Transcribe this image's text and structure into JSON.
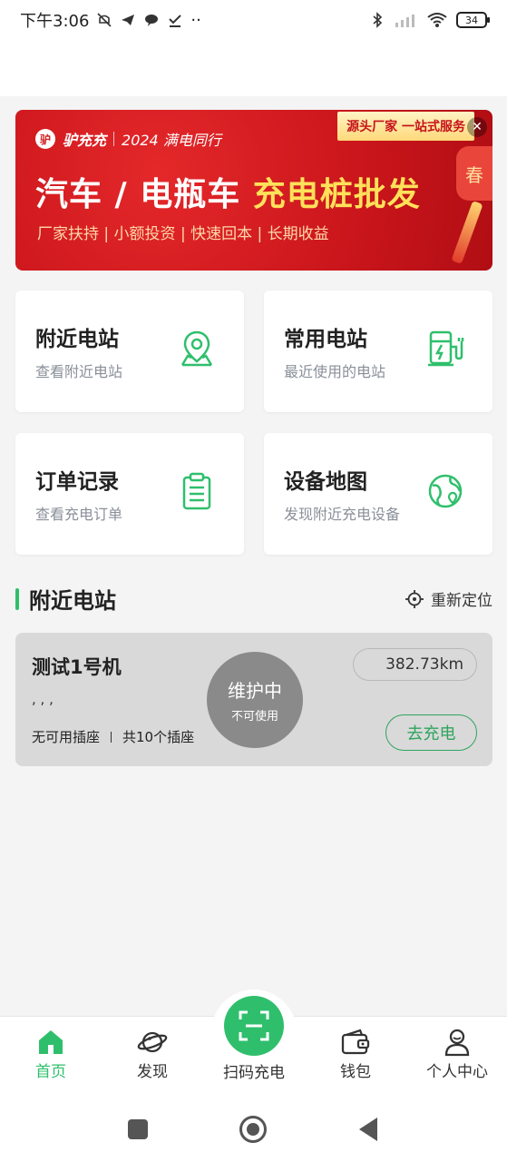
{
  "status_bar": {
    "time": "下午3:06",
    "battery": "34"
  },
  "banner": {
    "brand": "驴充充",
    "slogan": "2024 满电同行",
    "tag": "源头厂家 一站式服务",
    "headline_white": "汽车 / 电瓶车 ",
    "headline_yellow": "充电桩批发",
    "subline": "厂家扶持 | 小额投资 | 快速回本 | 长期收益",
    "side_text": "春"
  },
  "cards": [
    {
      "title": "附近电站",
      "subtitle": "查看附近电站",
      "icon": "map-pin-icon"
    },
    {
      "title": "常用电站",
      "subtitle": "最近使用的电站",
      "icon": "charging-station-icon"
    },
    {
      "title": "订单记录",
      "subtitle": "查看充电订单",
      "icon": "clipboard-icon"
    },
    {
      "title": "设备地图",
      "subtitle": "发现附近充电设备",
      "icon": "globe-icon"
    }
  ],
  "section": {
    "title": "附近电站",
    "relocate_label": "重新定位"
  },
  "station": {
    "name": "测试1号机",
    "address": ", , ,",
    "ports_available": "无可用插座",
    "ports_total": "共10个插座",
    "distance": "382.73km",
    "status": "维护中",
    "status_sub": "不可使用",
    "action": "去充电"
  },
  "tabbar": {
    "items": [
      {
        "label": "首页",
        "icon": "home-icon",
        "active": true
      },
      {
        "label": "发现",
        "icon": "planet-icon",
        "active": false
      },
      {
        "label": "扫码充电",
        "icon": "scan-icon",
        "active": false
      },
      {
        "label": "钱包",
        "icon": "wallet-icon",
        "active": false
      },
      {
        "label": "个人中心",
        "icon": "user-icon",
        "active": false
      }
    ]
  },
  "colors": {
    "accent": "#2fbf6c",
    "banner_red": "#d21d20"
  }
}
